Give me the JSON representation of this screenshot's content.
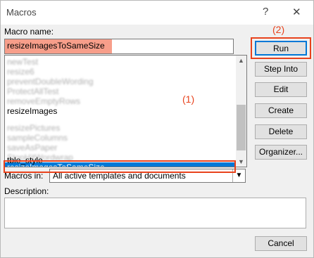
{
  "window": {
    "title": "Macros",
    "help_glyph": "?",
    "close_glyph": "✕"
  },
  "macro_name": {
    "label": "Macro name:",
    "value": "resizeImagesToSameSize"
  },
  "list": {
    "items": [
      {
        "label": "newTest",
        "blurred": true
      },
      {
        "label": "resize6",
        "blurred": true
      },
      {
        "label": "preventDoubleWording",
        "blurred": true
      },
      {
        "label": "ProtectAllTest",
        "blurred": true
      },
      {
        "label": "removeEmptyRows",
        "blurred": true
      },
      {
        "label": "resizeImages",
        "blurred": false
      },
      {
        "label": "resizeImagesToSameSize",
        "blurred": false,
        "selected": true
      },
      {
        "label": "resizePictures",
        "blurred": true
      },
      {
        "label": "sampleColumns",
        "blurred": true
      },
      {
        "label": "saveAsPaper",
        "blurred": true
      },
      {
        "label": "StopHitWordwrap",
        "blurred": true
      },
      {
        "label": "tble_style",
        "blurred": false
      }
    ]
  },
  "buttons": {
    "run": "Run",
    "step_into": "Step Into",
    "edit": "Edit",
    "create": "Create",
    "delete": "Delete",
    "organizer": "Organizer...",
    "cancel": "Cancel"
  },
  "annotations": {
    "one": "(1)",
    "two": "(2)"
  },
  "macros_in": {
    "label": "Macros in:",
    "value": "All active templates and documents"
  },
  "description": {
    "label": "Description:"
  },
  "colors": {
    "selection": "#0078d7",
    "annotation": "#e8421c",
    "highlight": "#f79e8a"
  }
}
